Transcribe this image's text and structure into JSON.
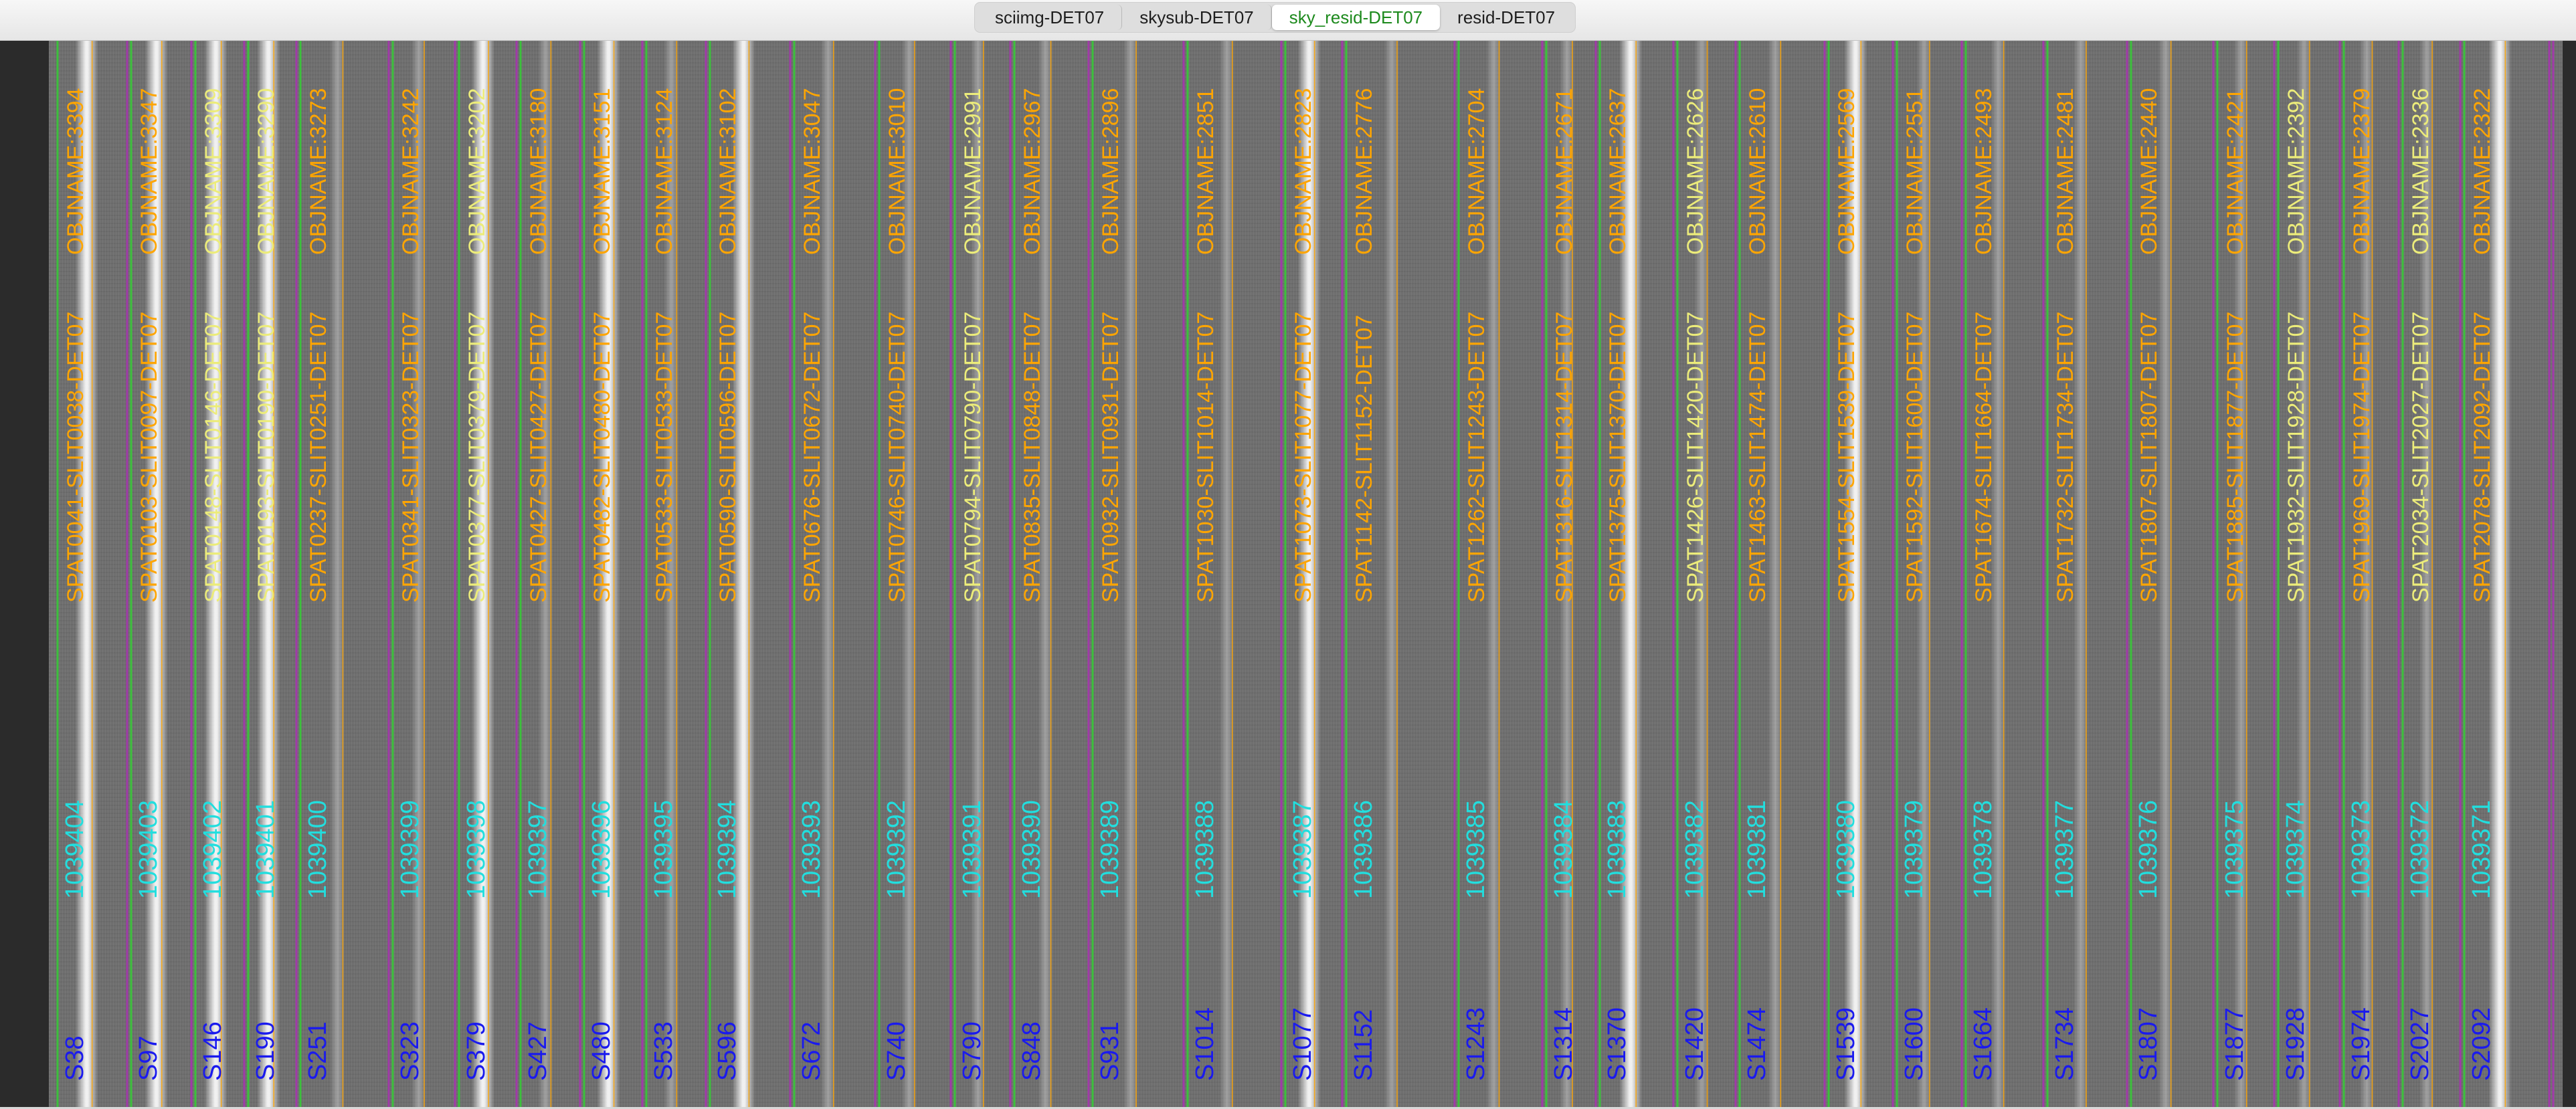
{
  "tabs": [
    {
      "label": "sciimg-DET07",
      "active": false
    },
    {
      "label": "skysub-DET07",
      "active": false
    },
    {
      "label": "sky_resid-DET07",
      "active": true
    },
    {
      "label": "resid-DET07",
      "active": false
    }
  ],
  "colors": {
    "slit_left": "#3cc03c",
    "slit_right": "#a03aa8",
    "trace": "#ffa500",
    "label_orange": "#ffa500",
    "label_yellow": "#ecec7a",
    "label_cyan": "#22dede",
    "label_blue": "#1a1aee",
    "active_tab": "#1d8a1d"
  },
  "slits": [
    {
      "spat": "S38",
      "id": "1039404",
      "name": "SPAT0041-SLIT0038-DET07",
      "obj": "OBJNAME:3394",
      "obj_color": "orange"
    },
    {
      "spat": "S97",
      "id": "1039403",
      "name": "SPAT0103-SLIT0097-DET07",
      "obj": "OBJNAME:3347",
      "obj_color": "orange"
    },
    {
      "spat": "S146",
      "id": "1039402",
      "name": "SPAT0148-SLIT0146-DET07",
      "obj": "OBJNAME:3309",
      "obj_color": "yellow"
    },
    {
      "spat": "S190",
      "id": "1039401",
      "name": "SPAT0193-SLIT0190-DET07",
      "obj": "OBJNAME:3290",
      "obj_color": "yellow"
    },
    {
      "spat": "S251",
      "id": "1039400",
      "name": "SPAT0237-SLIT0251-DET07",
      "obj": "OBJNAME:3273",
      "obj_color": "orange"
    },
    {
      "spat": "S323",
      "id": "1039399",
      "name": "SPAT0341-SLIT0323-DET07",
      "obj": "OBJNAME:3242",
      "obj_color": "orange"
    },
    {
      "spat": "S379",
      "id": "1039398",
      "name": "SPAT0377-SLIT0379-DET07",
      "obj": "OBJNAME:3202",
      "obj_color": "yellow"
    },
    {
      "spat": "S427",
      "id": "1039397",
      "name": "SPAT0427-SLIT0427-DET07",
      "obj": "OBJNAME:3180",
      "obj_color": "orange"
    },
    {
      "spat": "S480",
      "id": "1039396",
      "name": "SPAT0482-SLIT0480-DET07",
      "obj": "OBJNAME:3151",
      "obj_color": "orange"
    },
    {
      "spat": "S533",
      "id": "1039395",
      "name": "SPAT0533-SLIT0533-DET07",
      "obj": "OBJNAME:3124",
      "obj_color": "orange"
    },
    {
      "spat": "S596",
      "id": "1039394",
      "name": "SPAT0590-SLIT0596-DET07",
      "obj": "OBJNAME:3102",
      "obj_color": "orange"
    },
    {
      "spat": "S672",
      "id": "1039393",
      "name": "SPAT0676-SLIT0672-DET07",
      "obj": "OBJNAME:3047",
      "obj_color": "orange"
    },
    {
      "spat": "S740",
      "id": "1039392",
      "name": "SPAT0746-SLIT0740-DET07",
      "obj": "OBJNAME:3010",
      "obj_color": "orange"
    },
    {
      "spat": "S790",
      "id": "1039391",
      "name": "SPAT0794-SLIT0790-DET07",
      "obj": "OBJNAME:2991",
      "obj_color": "yellow"
    },
    {
      "spat": "S848",
      "id": "1039390",
      "name": "SPAT0835-SLIT0848-DET07",
      "obj": "OBJNAME:2967",
      "obj_color": "orange"
    },
    {
      "spat": "S931",
      "id": "1039389",
      "name": "SPAT0932-SLIT0931-DET07",
      "obj": "OBJNAME:2896",
      "obj_color": "orange"
    },
    {
      "spat": "S1014",
      "id": "1039388",
      "name": "SPAT1030-SLIT1014-DET07",
      "obj": "OBJNAME:2851",
      "obj_color": "orange"
    },
    {
      "spat": "S1077",
      "id": "1039387",
      "name": "SPAT1073-SLIT1077-DET07",
      "obj": "OBJNAME:2823",
      "obj_color": "orange"
    },
    {
      "spat": "S1152",
      "id": "1039386",
      "name": "SPAT1142-SLIT1152-DET07",
      "obj": "OBJNAME:2776",
      "obj_color": "orange"
    },
    {
      "spat": "S1243",
      "id": "1039385",
      "name": "SPAT1262-SLIT1243-DET07",
      "obj": "OBJNAME:2704",
      "obj_color": "orange"
    },
    {
      "spat": "S1314",
      "id": "1039384",
      "name": "SPAT1316-SLIT1314-DET07",
      "obj": "OBJNAME:2671",
      "obj_color": "orange"
    },
    {
      "spat": "S1370",
      "id": "1039383",
      "name": "SPAT1375-SLIT1370-DET07",
      "obj": "OBJNAME:2637",
      "obj_color": "orange"
    },
    {
      "spat": "S1420",
      "id": "1039382",
      "name": "SPAT1426-SLIT1420-DET07",
      "obj": "OBJNAME:2626",
      "obj_color": "yellow"
    },
    {
      "spat": "S1474",
      "id": "1039381",
      "name": "SPAT1463-SLIT1474-DET07",
      "obj": "OBJNAME:2610",
      "obj_color": "orange"
    },
    {
      "spat": "S1539",
      "id": "1039380",
      "name": "SPAT1554-SLIT1539-DET07",
      "obj": "OBJNAME:2569",
      "obj_color": "orange"
    },
    {
      "spat": "S1600",
      "id": "1039379",
      "name": "SPAT1592-SLIT1600-DET07",
      "obj": "OBJNAME:2551",
      "obj_color": "orange"
    },
    {
      "spat": "S1664",
      "id": "1039378",
      "name": "SPAT1674-SLIT1664-DET07",
      "obj": "OBJNAME:2493",
      "obj_color": "orange"
    },
    {
      "spat": "S1734",
      "id": "1039377",
      "name": "SPAT1732-SLIT1734-DET07",
      "obj": "OBJNAME:2481",
      "obj_color": "orange"
    },
    {
      "spat": "S1807",
      "id": "1039376",
      "name": "SPAT1807-SLIT1807-DET07",
      "obj": "OBJNAME:2440",
      "obj_color": "orange"
    },
    {
      "spat": "S1877",
      "id": "1039375",
      "name": "SPAT1885-SLIT1877-DET07",
      "obj": "OBJNAME:2421",
      "obj_color": "orange"
    },
    {
      "spat": "S1928",
      "id": "1039374",
      "name": "SPAT1932-SLIT1928-DET07",
      "obj": "OBJNAME:2392",
      "obj_color": "yellow"
    },
    {
      "spat": "S1974",
      "id": "1039373",
      "name": "SPAT1969-SLIT1974-DET07",
      "obj": "OBJNAME:2379",
      "obj_color": "orange"
    },
    {
      "spat": "S2027",
      "id": "1039372",
      "name": "SPAT2034-SLIT2027-DET07",
      "obj": "OBJNAME:2336",
      "obj_color": "yellow"
    },
    {
      "spat": "S2092",
      "id": "1039371",
      "name": "SPAT2078-SLIT2092-DET07",
      "obj": "OBJNAME:2322",
      "obj_color": "orange"
    }
  ]
}
